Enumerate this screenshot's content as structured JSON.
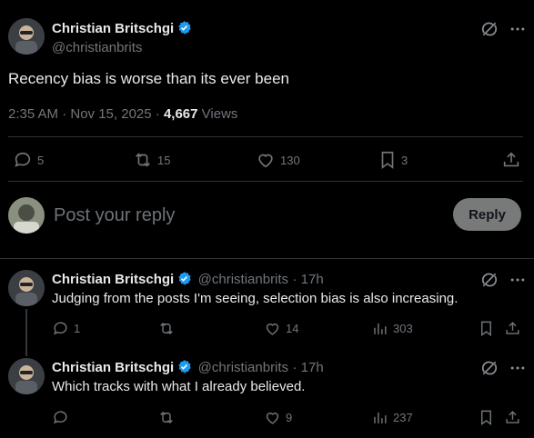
{
  "main_post": {
    "author_name": "Christian Britschgi",
    "handle": "@christianbrits",
    "text": "Recency bias is worse than its ever been",
    "time": "2:35 AM · Nov 15, 2025",
    "separator": "·",
    "views_count": "4,667",
    "views_label": "Views",
    "replies": "5",
    "reposts": "15",
    "likes": "130",
    "bookmarks": "3"
  },
  "compose": {
    "placeholder": "Post your reply",
    "reply_label": "Reply"
  },
  "replies": [
    {
      "author_name": "Christian Britschgi",
      "handle": "@christianbrits",
      "time": "· 17h",
      "text": "Judging from the posts I'm seeing, selection bias is also increasing.",
      "replies": "1",
      "reposts": "",
      "likes": "14",
      "views": "303"
    },
    {
      "author_name": "Christian Britschgi",
      "handle": "@christianbrits",
      "time": "· 17h",
      "text": "Which tracks with what I already believed.",
      "replies": "",
      "reposts": "",
      "likes": "9",
      "views": "237"
    }
  ],
  "colors": {
    "background": "#000000",
    "text": "#e7e9ea",
    "muted": "#71767b",
    "verified": "#1d9bf0",
    "divider": "#2f3336"
  }
}
